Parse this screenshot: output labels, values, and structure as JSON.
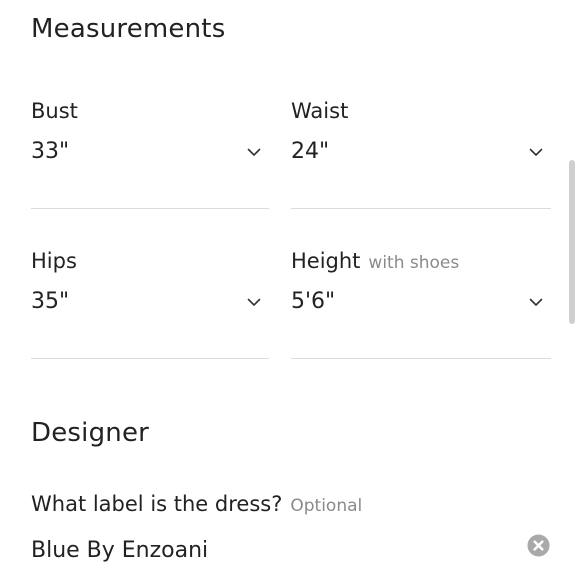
{
  "measurements": {
    "title": "Measurements",
    "bust": {
      "label": "Bust",
      "value": "33\""
    },
    "waist": {
      "label": "Waist",
      "value": "24\""
    },
    "hips": {
      "label": "Hips",
      "value": "35\""
    },
    "height": {
      "label": "Height",
      "hint": "with shoes",
      "value": "5'6\""
    }
  },
  "designer": {
    "title": "Designer",
    "question": "What label is the dress?",
    "hint": "Optional",
    "value": "Blue By Enzoani"
  },
  "icons": {
    "dropdown": "chevron-down-icon",
    "clear": "clear-circle-icon"
  },
  "colors": {
    "text": "#222222",
    "hint": "#8a8a8a",
    "divider": "#dcdcdc",
    "clear_icon": "#a9a9a9"
  }
}
